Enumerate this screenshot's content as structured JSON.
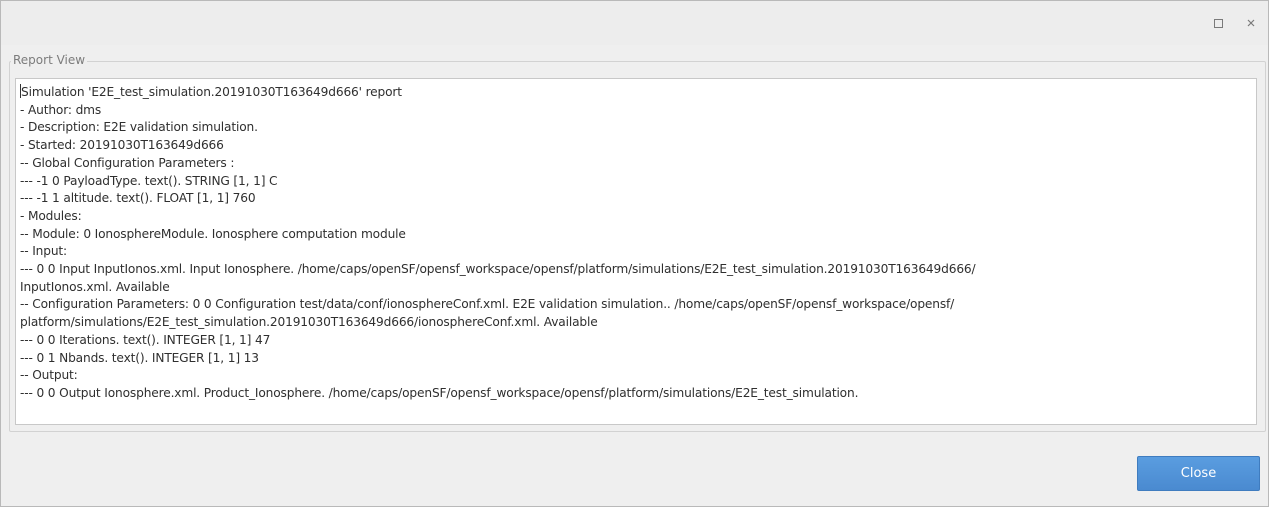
{
  "window": {
    "title": ""
  },
  "report_view": {
    "group_label": "Report View",
    "lines": [
      "Simulation 'E2E_test_simulation.20191030T163649d666' report",
      "- Author: dms",
      "- Description: E2E validation simulation.",
      "- Started: 20191030T163649d666",
      "-- Global Configuration Parameters :",
      "--- -1 0 PayloadType. text(). STRING [1, 1] C",
      "--- -1 1 altitude. text(). FLOAT [1, 1] 760",
      "- Modules:",
      "-- Module: 0 IonosphereModule. Ionosphere computation module",
      "-- Input:",
      "--- 0 0 Input InputIonos.xml. Input Ionosphere. /home/caps/openSF/opensf_workspace/opensf/platform/simulations/E2E_test_simulation.20191030T163649d666/",
      "InputIonos.xml. Available",
      "-- Configuration Parameters: 0 0 Configuration test/data/conf/ionosphereConf.xml. E2E validation simulation.. /home/caps/openSF/opensf_workspace/opensf/",
      "platform/simulations/E2E_test_simulation.20191030T163649d666/ionosphereConf.xml. Available",
      "--- 0 0 Iterations. text(). INTEGER [1, 1] 47",
      "--- 0 1 Nbands. text(). INTEGER [1, 1] 13",
      "-- Output:",
      "--- 0 0 Output Ionosphere.xml. Product_Ionosphere. /home/caps/openSF/opensf_workspace/opensf/platform/simulations/E2E_test_simulation."
    ]
  },
  "buttons": {
    "close_label": "Close"
  },
  "colors": {
    "accent": "#4a8ad0",
    "window_bg": "#efefef",
    "text": "#2f2f2f"
  },
  "icons": {
    "maximize": "maximize-icon",
    "close": "close-icon"
  }
}
